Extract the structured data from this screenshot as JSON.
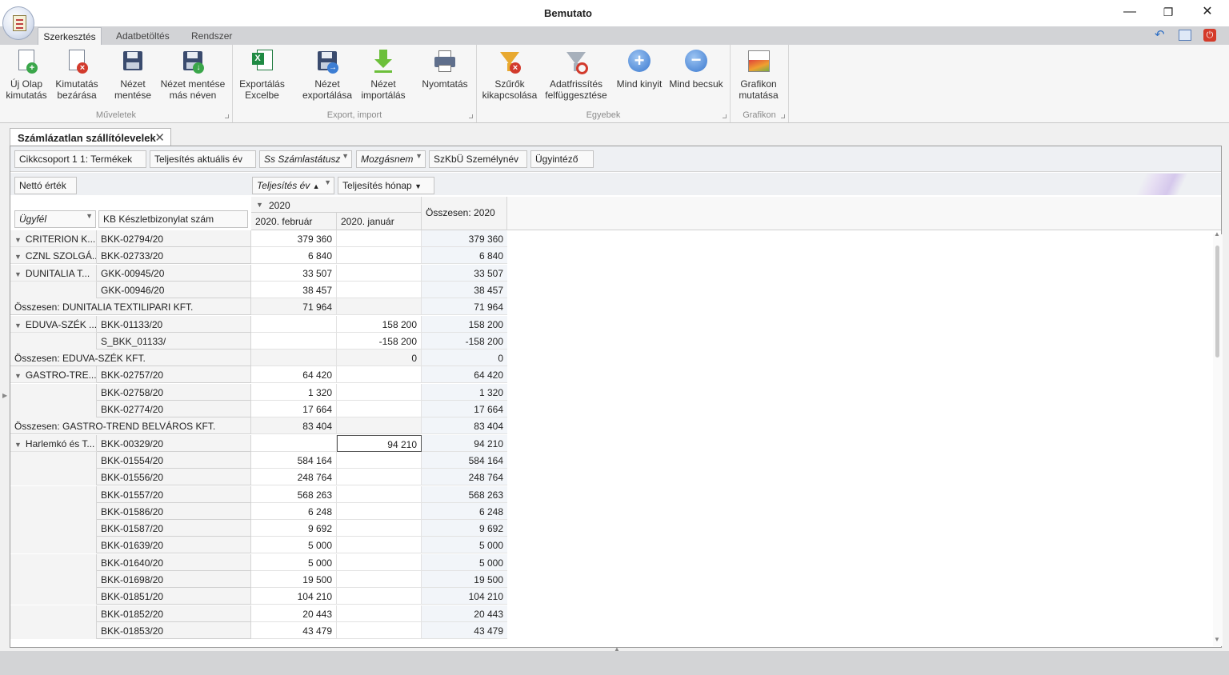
{
  "window": {
    "title": "Bemutato",
    "minimize": "—",
    "restore": "❐",
    "close": "✕"
  },
  "ribbon_tabs": [
    "Szerkesztés",
    "Adatbetöltés",
    "Rendszer"
  ],
  "ribbon": {
    "groups": [
      "Műveletek",
      "Export, import",
      "Egyebek",
      "Grafikon"
    ],
    "buttons": {
      "uj_olap": "Új Olap\nkimutatás",
      "kimutatas_bezarasa": "Kimutatás\nbezárása",
      "nezet_mentese": "Nézet\nmentése",
      "nezet_mentese_mas": "Nézet mentése\nmás néven",
      "export_excel": "Exportálás\nExcelbe",
      "nezet_export": "Nézet\nexportálása",
      "nezet_import": "Nézet\nimportálás",
      "nyomtatas": "Nyomtatás",
      "szurok_kikapcs": "Szűrők\nkikapcsolása",
      "adatfrissites": "Adatfrissítés\nfelfüggesztése",
      "mind_kinyit": "Mind kinyit",
      "mind_becsuk": "Mind becsuk",
      "grafikon": "Grafikon\nmutatása"
    }
  },
  "doc_tab": {
    "title": "Számlázatlan szállítólevelek"
  },
  "filter_fields": [
    "Cikkcsoport 1 1: Termékek",
    "Teljesítés aktuális év",
    "Ss Számlastátusz",
    "Mozgásnem",
    "SzKbÜ Személynév",
    "Ügyintéző"
  ],
  "data_field": "Nettó érték",
  "column_fields": [
    "Teljesítés év",
    "Teljesítés hónap"
  ],
  "row_fields": [
    "Ügyfél",
    "KB Készletbizonylat szám"
  ],
  "column_headers": {
    "year": "2020",
    "month1": "2020. február",
    "month2": "2020. január",
    "total": "Összesen: 2020"
  },
  "rows": [
    {
      "ugyfel": "CRITERION K...",
      "bizonylat": "BKK-02794/20",
      "feb": "379 360",
      "jan": "",
      "total": "379 360",
      "type": "data",
      "expand": true
    },
    {
      "ugyfel": "CZNL SZOLGÁ...",
      "bizonylat": "BKK-02733/20",
      "feb": "6 840",
      "jan": "",
      "total": "6 840",
      "type": "data",
      "expand": true
    },
    {
      "ugyfel": "DUNITALIA T...",
      "bizonylat": "GKK-00945/20",
      "feb": "33 507",
      "jan": "",
      "total": "33 507",
      "type": "data",
      "expand": true
    },
    {
      "ugyfel": "",
      "bizonylat": "GKK-00946/20",
      "feb": "38 457",
      "jan": "",
      "total": "38 457",
      "type": "data"
    },
    {
      "label": "Összesen: DUNITALIA TEXTILIPARI KFT.",
      "feb": "71 964",
      "jan": "",
      "total": "71 964",
      "type": "sum"
    },
    {
      "ugyfel": "EDUVA-SZÉK ...",
      "bizonylat": "BKK-01133/20",
      "feb": "",
      "jan": "158 200",
      "total": "158 200",
      "type": "data",
      "expand": true
    },
    {
      "ugyfel": "",
      "bizonylat": "S_BKK_01133/",
      "feb": "",
      "jan": "-158 200",
      "total": "-158 200",
      "type": "data"
    },
    {
      "label": "Összesen: EDUVA-SZÉK KFT.",
      "feb": "",
      "jan": "0",
      "total": "0",
      "type": "sum"
    },
    {
      "ugyfel": "GASTRO-TRE...",
      "bizonylat": "BKK-02757/20",
      "feb": "64 420",
      "jan": "",
      "total": "64 420",
      "type": "data",
      "expand": true
    },
    {
      "ugyfel": "",
      "bizonylat": "BKK-02758/20",
      "feb": "1 320",
      "jan": "",
      "total": "1 320",
      "type": "data"
    },
    {
      "ugyfel": "",
      "bizonylat": "BKK-02774/20",
      "feb": "17 664",
      "jan": "",
      "total": "17 664",
      "type": "data"
    },
    {
      "label": "Összesen: GASTRO-TREND BELVÁROS KFT.",
      "feb": "83 404",
      "jan": "",
      "total": "83 404",
      "type": "sum"
    },
    {
      "ugyfel": "Harlemkó és T...",
      "bizonylat": "BKK-00329/20",
      "feb": "",
      "jan": "94 210",
      "total": "94 210",
      "type": "data",
      "expand": true,
      "selected": true
    },
    {
      "ugyfel": "",
      "bizonylat": "BKK-01554/20",
      "feb": "584 164",
      "jan": "",
      "total": "584 164",
      "type": "data"
    },
    {
      "ugyfel": "",
      "bizonylat": "BKK-01556/20",
      "feb": "248 764",
      "jan": "",
      "total": "248 764",
      "type": "data"
    },
    {
      "ugyfel": "",
      "bizonylat": "BKK-01557/20",
      "feb": "568 263",
      "jan": "",
      "total": "568 263",
      "type": "data"
    },
    {
      "ugyfel": "",
      "bizonylat": "BKK-01586/20",
      "feb": "6 248",
      "jan": "",
      "total": "6 248",
      "type": "data"
    },
    {
      "ugyfel": "",
      "bizonylat": "BKK-01587/20",
      "feb": "9 692",
      "jan": "",
      "total": "9 692",
      "type": "data"
    },
    {
      "ugyfel": "",
      "bizonylat": "BKK-01639/20",
      "feb": "5 000",
      "jan": "",
      "total": "5 000",
      "type": "data"
    },
    {
      "ugyfel": "",
      "bizonylat": "BKK-01640/20",
      "feb": "5 000",
      "jan": "",
      "total": "5 000",
      "type": "data"
    },
    {
      "ugyfel": "",
      "bizonylat": "BKK-01698/20",
      "feb": "19 500",
      "jan": "",
      "total": "19 500",
      "type": "data"
    },
    {
      "ugyfel": "",
      "bizonylat": "BKK-01851/20",
      "feb": "104 210",
      "jan": "",
      "total": "104 210",
      "type": "data"
    },
    {
      "ugyfel": "",
      "bizonylat": "BKK-01852/20",
      "feb": "20 443",
      "jan": "",
      "total": "20 443",
      "type": "data"
    },
    {
      "ugyfel": "",
      "bizonylat": "BKK-01853/20",
      "feb": "43 479",
      "jan": "",
      "total": "43 479",
      "type": "data"
    }
  ],
  "colors": {
    "accent": "#5b8ad6",
    "header_bg": "#f4f4f4",
    "total_bg": "#f2f5f9"
  }
}
